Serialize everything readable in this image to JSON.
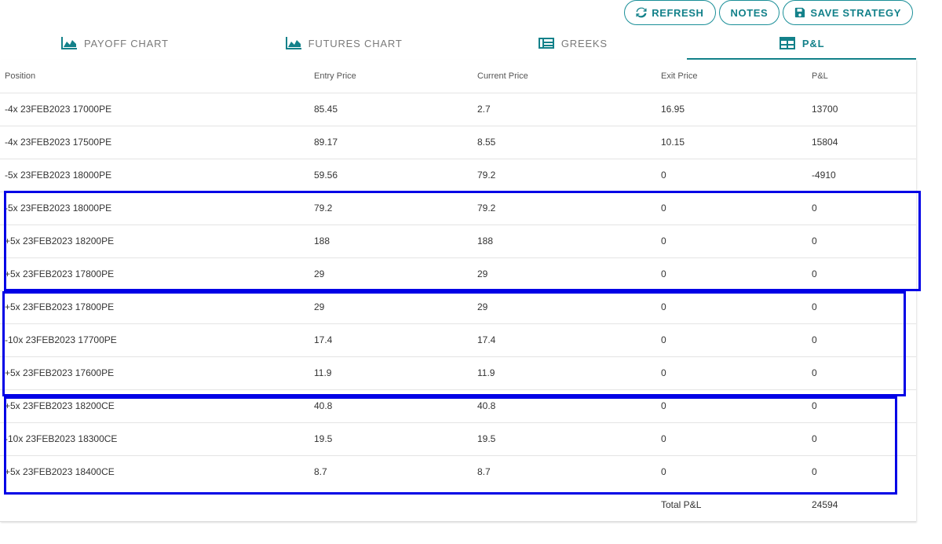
{
  "toolbar": {
    "refresh_label": "REFRESH",
    "notes_label": "NOTES",
    "save_label": "SAVE STRATEGY"
  },
  "tabs": [
    {
      "label": "PAYOFF CHART",
      "icon": "area-chart-icon"
    },
    {
      "label": "FUTURES CHART",
      "icon": "area-chart-icon"
    },
    {
      "label": "GREEKS",
      "icon": "newspaper-icon"
    },
    {
      "label": "P&L",
      "icon": "table-grid-icon",
      "active": true
    }
  ],
  "table": {
    "headers": [
      "Position",
      "Entry Price",
      "Current Price",
      "Exit Price",
      "P&L"
    ],
    "rows": [
      [
        "-4x 23FEB2023 17000PE",
        "85.45",
        "2.7",
        "16.95",
        "13700"
      ],
      [
        "-4x 23FEB2023 17500PE",
        "89.17",
        "8.55",
        "10.15",
        "15804"
      ],
      [
        "-5x 23FEB2023 18000PE",
        "59.56",
        "79.2",
        "0",
        "-4910"
      ],
      [
        "-5x 23FEB2023 18000PE",
        "79.2",
        "79.2",
        "0",
        "0"
      ],
      [
        "+5x 23FEB2023 18200PE",
        "188",
        "188",
        "0",
        "0"
      ],
      [
        "+5x 23FEB2023 17800PE",
        "29",
        "29",
        "0",
        "0"
      ],
      [
        "+5x 23FEB2023 17800PE",
        "29",
        "29",
        "0",
        "0"
      ],
      [
        "-10x 23FEB2023 17700PE",
        "17.4",
        "17.4",
        "0",
        "0"
      ],
      [
        "+5x 23FEB2023 17600PE",
        "11.9",
        "11.9",
        "0",
        "0"
      ],
      [
        "+5x 23FEB2023 18200CE",
        "40.8",
        "40.8",
        "0",
        "0"
      ],
      [
        "-10x 23FEB2023 18300CE",
        "19.5",
        "19.5",
        "0",
        "0"
      ],
      [
        "+5x 23FEB2023 18400CE",
        "8.7",
        "8.7",
        "0",
        "0"
      ]
    ],
    "total_label": "Total P&L",
    "total_value": "24594"
  },
  "colors": {
    "accent": "#13818a",
    "highlight_box": "#0000e6"
  }
}
